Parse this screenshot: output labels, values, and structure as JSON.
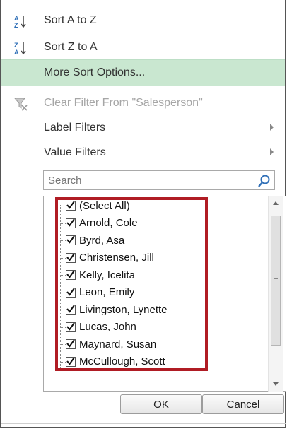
{
  "menu": {
    "sort_az": "Sort A to Z",
    "sort_za": "Sort Z to A",
    "more_sort": "More Sort Options...",
    "clear_filter": "Clear Filter From \"Salesperson\"",
    "label_filters": "Label Filters",
    "value_filters": "Value Filters"
  },
  "search": {
    "placeholder": "Search"
  },
  "list": {
    "items": [
      {
        "label": "(Select All)",
        "checked": true
      },
      {
        "label": "Arnold, Cole",
        "checked": true
      },
      {
        "label": "Byrd, Asa",
        "checked": true
      },
      {
        "label": "Christensen, Jill",
        "checked": true
      },
      {
        "label": "Kelly, Icelita",
        "checked": true
      },
      {
        "label": "Leon, Emily",
        "checked": true
      },
      {
        "label": "Livingston, Lynette",
        "checked": true
      },
      {
        "label": "Lucas, John",
        "checked": true
      },
      {
        "label": "Maynard, Susan",
        "checked": true
      },
      {
        "label": "McCullough, Scott",
        "checked": true
      }
    ]
  },
  "buttons": {
    "ok": "OK",
    "cancel": "Cancel"
  },
  "colors": {
    "hover": "#c9e7d0",
    "highlight_border": "#b01c24"
  },
  "icons": {
    "sort_az": "sort-ascending-icon",
    "sort_za": "sort-descending-icon",
    "clear_filter": "clear-filter-icon",
    "search": "magnifier-icon"
  }
}
